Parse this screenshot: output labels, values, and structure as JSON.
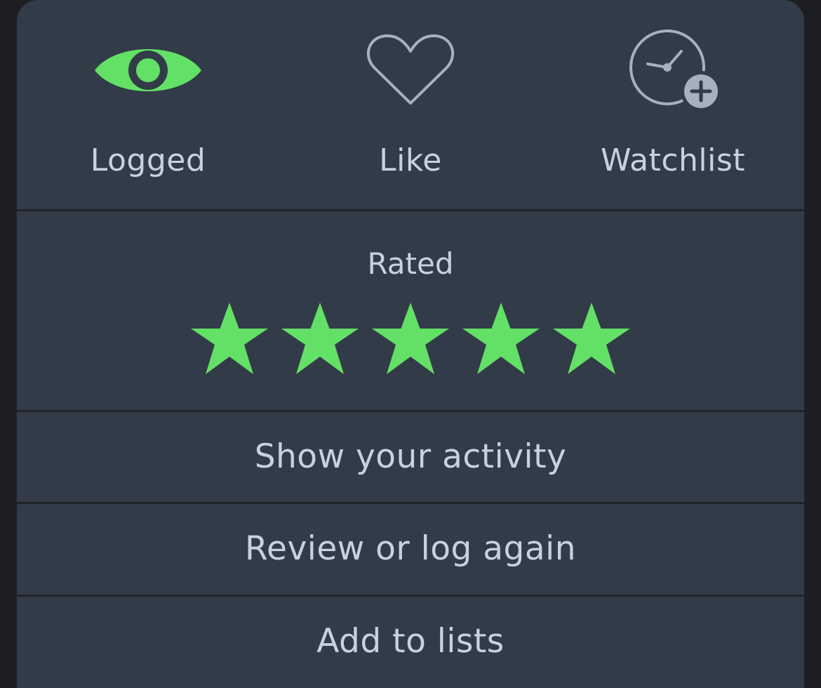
{
  "colors": {
    "accent": "#63e066",
    "sheet_bg": "#323b48",
    "text": "#c7d2e1",
    "icon_outline": "#a7b1be",
    "divider": "#1e232a"
  },
  "actions": [
    {
      "label": "Logged",
      "icon": "eye-icon",
      "active": true
    },
    {
      "label": "Like",
      "icon": "heart-outline-icon",
      "active": false
    },
    {
      "label": "Watchlist",
      "icon": "clock-plus-icon",
      "active": false
    }
  ],
  "rating": {
    "label": "Rated",
    "stars": 5,
    "max_stars": 5
  },
  "menu": [
    {
      "label": "Show your activity"
    },
    {
      "label": "Review or log again"
    },
    {
      "label": "Add to lists"
    }
  ]
}
